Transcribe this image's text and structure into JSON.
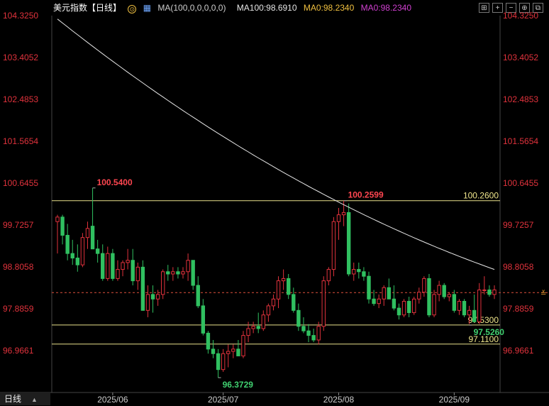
{
  "header": {
    "title": "美元指数【日线】",
    "ma_label": "MA(100,0,0,0,0,0)",
    "ma100": "MA100:98.6910",
    "ma0a": "MA0:98.2340",
    "ma0b": "MA0:98.2340",
    "colors": {
      "title": "#ffffff",
      "ma100": "#e6e6e6",
      "ma0a": "#f0c040",
      "ma0b": "#d040d0"
    },
    "tool_icons": [
      "grid-icon",
      "cross-icon",
      "zoom-out-icon",
      "zoom-in-icon",
      "popout-icon"
    ]
  },
  "footer": {
    "period_label": "日线",
    "arrow": "▲"
  },
  "chart_data": {
    "type": "candlestick",
    "y_ticks": [
      "104.3250",
      "103.4052",
      "102.4853",
      "101.5654",
      "100.6455",
      "99.7257",
      "98.8058",
      "97.8859",
      "96.9661"
    ],
    "x_ticks": [
      "2025/06",
      "2025/07",
      "2025/08",
      "2025/09"
    ],
    "horizontal_lines": [
      {
        "value": 100.26,
        "label": "100.2600"
      },
      {
        "value": 97.53,
        "label": "97.5300"
      },
      {
        "value": 97.11,
        "label": "97.1100"
      }
    ],
    "last_price_line": 98.24,
    "annotations": [
      {
        "value": 100.54,
        "label": "100.5400",
        "kind": "high"
      },
      {
        "value": 100.2599,
        "label": "100.2599",
        "kind": "high"
      },
      {
        "value": 96.3729,
        "label": "96.3729",
        "kind": "low"
      },
      {
        "value": 97.526,
        "label": "97.5260",
        "kind": "low"
      }
    ],
    "candles": [
      [
        99.8,
        99.95,
        99.1,
        99.9
      ],
      [
        99.9,
        99.95,
        99.3,
        99.5
      ],
      [
        99.5,
        99.75,
        98.95,
        99.1
      ],
      [
        99.1,
        99.4,
        98.85,
        99.0
      ],
      [
        99.0,
        99.3,
        98.7,
        98.85
      ],
      [
        98.85,
        99.55,
        98.8,
        99.45
      ],
      [
        99.45,
        99.8,
        99.2,
        99.65
      ],
      [
        99.7,
        100.54,
        99.2,
        99.2
      ],
      [
        99.2,
        99.4,
        98.9,
        99.1
      ],
      [
        99.1,
        99.3,
        98.5,
        98.55
      ],
      [
        98.55,
        99.25,
        98.5,
        99.1
      ],
      [
        99.1,
        99.2,
        98.5,
        98.55
      ],
      [
        98.55,
        98.95,
        98.5,
        98.75
      ],
      [
        98.75,
        98.95,
        98.6,
        98.9
      ],
      [
        98.9,
        99.2,
        98.75,
        98.95
      ],
      [
        98.95,
        99.2,
        98.4,
        98.5
      ],
      [
        98.5,
        98.9,
        98.3,
        98.8
      ],
      [
        98.8,
        98.95,
        97.9,
        97.85
      ],
      [
        97.85,
        98.4,
        97.7,
        98.2
      ],
      [
        98.2,
        98.4,
        97.8,
        98.1
      ],
      [
        98.1,
        98.3,
        97.95,
        98.2
      ],
      [
        98.2,
        98.75,
        98.1,
        98.7
      ],
      [
        98.7,
        98.85,
        98.5,
        98.65
      ],
      [
        98.65,
        98.8,
        98.5,
        98.7
      ],
      [
        98.7,
        98.8,
        98.55,
        98.65
      ],
      [
        98.65,
        98.8,
        98.55,
        98.7
      ],
      [
        98.7,
        99.1,
        98.5,
        98.95
      ],
      [
        98.95,
        98.95,
        98.3,
        98.4
      ],
      [
        98.4,
        98.6,
        97.9,
        97.95
      ],
      [
        97.95,
        98.1,
        97.3,
        97.35
      ],
      [
        97.35,
        97.4,
        96.9,
        97.0
      ],
      [
        97.0,
        97.2,
        96.8,
        96.9
      ],
      [
        96.9,
        97.0,
        96.37,
        96.55
      ],
      [
        96.55,
        97.0,
        96.5,
        96.9
      ],
      [
        96.9,
        97.1,
        96.6,
        96.95
      ],
      [
        96.95,
        97.1,
        96.8,
        97.0
      ],
      [
        97.0,
        97.2,
        96.9,
        96.85
      ],
      [
        96.85,
        97.4,
        96.8,
        97.3
      ],
      [
        97.3,
        97.6,
        97.15,
        97.45
      ],
      [
        97.45,
        97.6,
        97.35,
        97.5
      ],
      [
        97.5,
        97.8,
        97.35,
        97.45
      ],
      [
        97.45,
        97.85,
        97.4,
        97.75
      ],
      [
        97.75,
        98.0,
        97.6,
        97.95
      ],
      [
        97.95,
        98.2,
        97.85,
        98.1
      ],
      [
        98.1,
        98.6,
        97.9,
        98.5
      ],
      [
        98.5,
        98.75,
        98.3,
        98.55
      ],
      [
        98.55,
        98.65,
        98.1,
        98.2
      ],
      [
        98.2,
        98.35,
        97.8,
        97.85
      ],
      [
        97.85,
        98.0,
        97.4,
        97.5
      ],
      [
        97.5,
        97.7,
        97.35,
        97.4
      ],
      [
        97.4,
        97.55,
        97.15,
        97.3
      ],
      [
        97.3,
        97.45,
        97.15,
        97.2
      ],
      [
        97.2,
        97.6,
        97.1,
        97.5
      ],
      [
        97.5,
        98.6,
        97.4,
        98.5
      ],
      [
        98.5,
        98.8,
        98.4,
        98.75
      ],
      [
        98.75,
        99.9,
        98.6,
        99.8
      ],
      [
        99.8,
        100.1,
        99.4,
        99.95
      ],
      [
        99.95,
        100.26,
        99.7,
        100.0
      ],
      [
        100.0,
        100.2,
        98.6,
        98.65
      ],
      [
        98.65,
        98.9,
        98.5,
        98.75
      ],
      [
        98.75,
        98.9,
        98.55,
        98.7
      ],
      [
        98.7,
        98.8,
        98.5,
        98.6
      ],
      [
        98.6,
        98.7,
        98.0,
        98.1
      ],
      [
        98.1,
        98.3,
        97.95,
        98.0
      ],
      [
        98.0,
        98.2,
        97.9,
        98.1
      ],
      [
        98.1,
        98.4,
        97.95,
        98.35
      ],
      [
        98.35,
        98.55,
        98.1,
        98.1
      ],
      [
        98.1,
        98.4,
        97.85,
        97.9
      ],
      [
        97.9,
        98.0,
        97.65,
        97.75
      ],
      [
        97.75,
        98.1,
        97.7,
        98.05
      ],
      [
        98.05,
        98.15,
        97.7,
        97.8
      ],
      [
        97.8,
        98.15,
        97.75,
        98.1
      ],
      [
        98.1,
        98.35,
        98.0,
        98.25
      ],
      [
        98.25,
        98.6,
        98.15,
        98.55
      ],
      [
        98.55,
        98.65,
        97.7,
        97.75
      ],
      [
        97.75,
        98.3,
        97.7,
        98.2
      ],
      [
        98.2,
        98.5,
        98.05,
        98.4
      ],
      [
        98.4,
        98.45,
        98.1,
        98.15
      ],
      [
        98.15,
        98.25,
        98.05,
        98.2
      ],
      [
        98.2,
        98.3,
        97.8,
        97.85
      ],
      [
        97.85,
        98.1,
        97.75,
        98.05
      ],
      [
        98.05,
        98.1,
        97.7,
        97.75
      ],
      [
        97.75,
        97.95,
        97.55,
        97.85
      ],
      [
        97.85,
        98.2,
        97.6,
        97.6
      ],
      [
        97.6,
        98.45,
        97.55,
        98.3
      ],
      [
        98.3,
        98.6,
        98.2,
        98.3
      ],
      [
        98.3,
        98.4,
        98.15,
        98.2
      ],
      [
        98.2,
        98.4,
        98.1,
        98.3
      ]
    ]
  }
}
